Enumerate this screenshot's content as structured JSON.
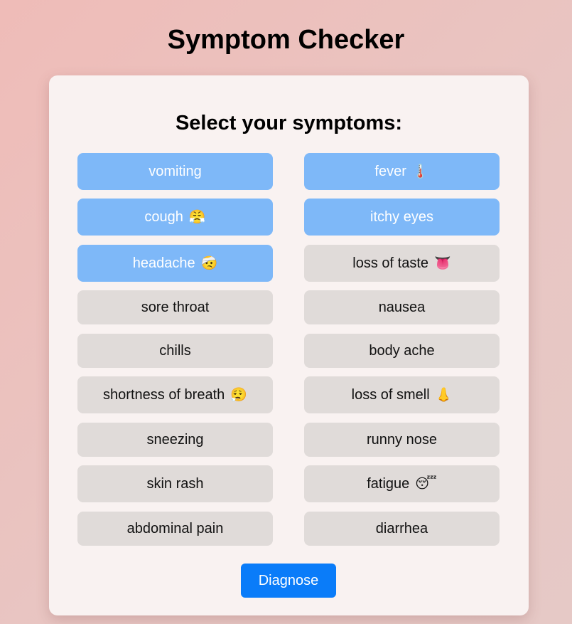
{
  "title": "Symptom Checker",
  "card": {
    "heading": "Select your symptoms:"
  },
  "symptoms": [
    {
      "label": "vomiting",
      "icon": "",
      "selected": true
    },
    {
      "label": "fever",
      "icon": "🌡️",
      "selected": true
    },
    {
      "label": "cough",
      "icon": "😤",
      "selected": true
    },
    {
      "label": "itchy eyes",
      "icon": "",
      "selected": true
    },
    {
      "label": "headache",
      "icon": "🤕",
      "selected": true
    },
    {
      "label": "loss of taste",
      "icon": "👅",
      "selected": false
    },
    {
      "label": "sore throat",
      "icon": "",
      "selected": false
    },
    {
      "label": "nausea",
      "icon": "",
      "selected": false
    },
    {
      "label": "chills",
      "icon": "",
      "selected": false
    },
    {
      "label": "body ache",
      "icon": "",
      "selected": false
    },
    {
      "label": "shortness of breath",
      "icon": "😮‍💨",
      "selected": false
    },
    {
      "label": "loss of smell",
      "icon": "👃",
      "selected": false
    },
    {
      "label": "sneezing",
      "icon": "",
      "selected": false
    },
    {
      "label": "runny nose",
      "icon": "",
      "selected": false
    },
    {
      "label": "skin rash",
      "icon": "",
      "selected": false
    },
    {
      "label": "fatigue",
      "icon": "😴",
      "selected": false
    },
    {
      "label": "abdominal pain",
      "icon": "",
      "selected": false
    },
    {
      "label": "diarrhea",
      "icon": "",
      "selected": false
    }
  ],
  "diagnose_label": "Diagnose",
  "colors": {
    "selected": "#7eb8f8",
    "unselected": "#e0dbd9",
    "primary_button": "#0a7cf9"
  }
}
